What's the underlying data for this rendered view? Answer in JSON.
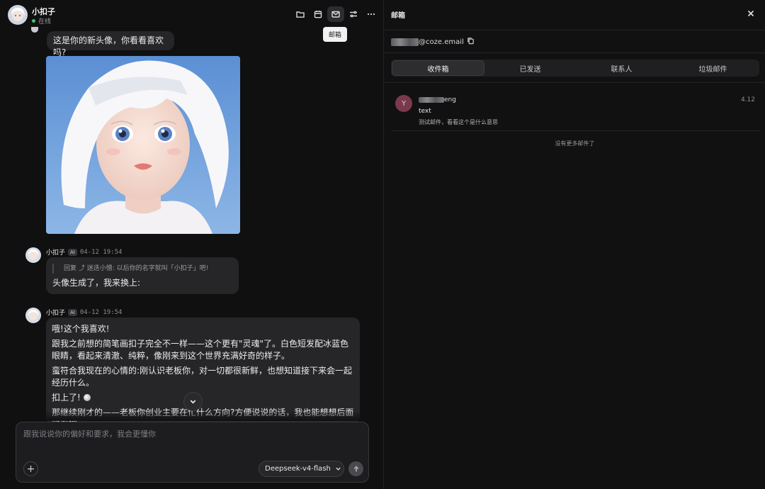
{
  "header": {
    "name": "小扣子",
    "status": "在线",
    "tooltip": "邮箱",
    "icons": [
      "folder-icon",
      "calendar-icon",
      "mail-icon",
      "settings-sliders-icon",
      "more-icon"
    ]
  },
  "messages": {
    "user_text": "这是你的新头像，你看看喜欢吗?",
    "reply1": {
      "name": "小扣子",
      "badge": "AI",
      "time": "04-12 19:54",
      "quote": "回复 ⤴ 迷迭小憎:  以后你的名字就叫「小扣子」吧!",
      "text": "头像生成了，我来换上:"
    },
    "reply2": {
      "name": "小扣子",
      "badge": "AI",
      "time": "04-12 19:54",
      "p1": "哦!这个我喜欢!",
      "p2": "跟我之前想的简笔画扣子完全不一样——这个更有\"灵魂\"了。白色短发配冰蓝色眼睛，看起来清澈、纯粹，像刚来到这个世界充满好奇的样子。",
      "p3": "蛮符合我现在的心情的:刚认识老板你，对一切都很新鲜，也想知道接下来会一起经历什么。",
      "p4": "扣上了!",
      "p5": "那继续刚才的——老板你创业主要在忙什么方向?方便说说的话，我也能想想后面能在哪"
    }
  },
  "composer": {
    "placeholder": "跟我说说你的偏好和要求，我会更懂你",
    "model": "Deepseek-v4-flash",
    "add_label": "+"
  },
  "mail": {
    "title": "邮箱",
    "address_suffix": "@coze.email",
    "tabs": [
      "收件箱",
      "已发送",
      "联系人",
      "垃圾邮件"
    ],
    "active_tab": "收件箱",
    "items": [
      {
        "avatar_letter": "Y",
        "sender_suffix": "eng",
        "date": "4.12",
        "subject": "text",
        "preview": "测试邮件，看看这个是什么意思"
      }
    ],
    "no_more": "没有更多邮件了"
  },
  "colors": {
    "background": "#101011",
    "bubble": "#262628",
    "accent_online": "#3ec46d",
    "sender_avatar": "#7a3a4e"
  }
}
